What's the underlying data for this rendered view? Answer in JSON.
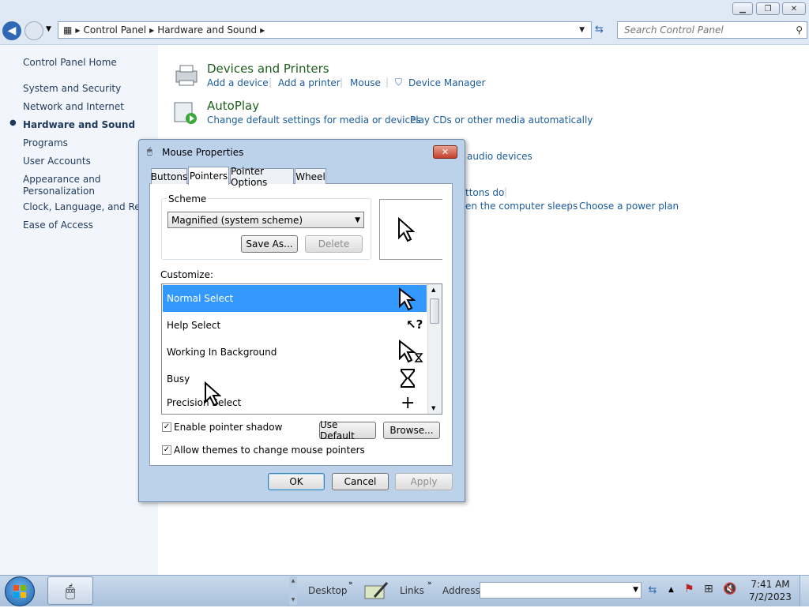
{
  "address": {
    "crumbs": [
      "Control Panel",
      "Hardware and Sound"
    ],
    "search_placeholder": "Search Control Panel"
  },
  "left_nav": {
    "home": "Control Panel Home",
    "items": [
      "System and Security",
      "Network and Internet",
      "Hardware and Sound",
      "Programs",
      "User Accounts",
      "Appearance and Personalization",
      "Clock, Language, and Regio",
      "Ease of Access"
    ]
  },
  "categories": {
    "devices": {
      "title": "Devices and Printers",
      "links": [
        "Add a device",
        "Add a printer",
        "Mouse",
        "Device Manager"
      ]
    },
    "autoplay": {
      "title": "AutoPlay",
      "links": [
        "Change default settings for media or devices",
        "Play CDs or other media automatically"
      ]
    },
    "sound_partial": "audio devices",
    "power_partial": [
      "ttons do",
      "en the computer sleeps",
      "Choose a power plan"
    ]
  },
  "dialog": {
    "title": "Mouse Properties",
    "tabs": [
      "Buttons",
      "Pointers",
      "Pointer Options",
      "Wheel"
    ],
    "active_tab": "Pointers",
    "scheme_label": "Scheme",
    "scheme_value": "Magnified (system scheme)",
    "save_as": "Save As...",
    "delete": "Delete",
    "customize_label": "Customize:",
    "pointer_rows": [
      "Normal Select",
      "Help Select",
      "Working In Background",
      "Busy",
      "Precision Select"
    ],
    "selected_row": "Normal Select",
    "enable_shadow": "Enable pointer shadow",
    "use_default": "Use Default",
    "browse": "Browse...",
    "allow_themes": "Allow themes to change mouse pointers",
    "ok": "OK",
    "cancel": "Cancel",
    "apply": "Apply",
    "checkmark": "✓"
  },
  "taskbar": {
    "desktop": "Desktop",
    "links": "Links",
    "address": "Address",
    "time": "7:41 AM",
    "date": "7/2/2023"
  },
  "colors": {
    "selection": "#3399ff",
    "link": "#1a5b9c",
    "category_title": "#1e5e1e"
  }
}
